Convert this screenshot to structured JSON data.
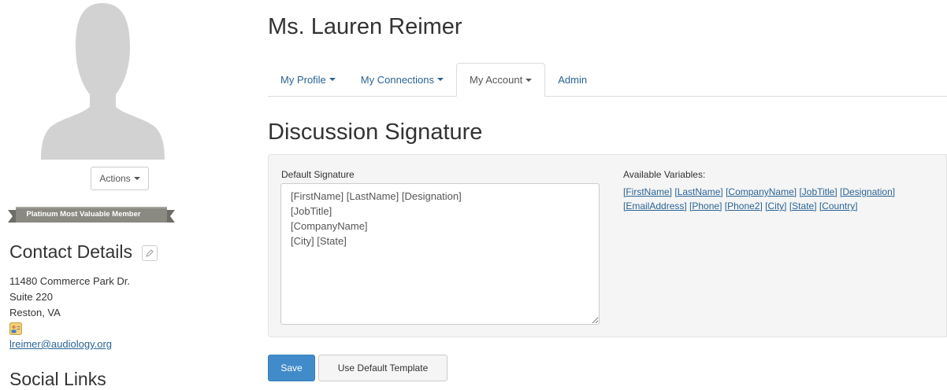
{
  "profile": {
    "actions_label": "Actions",
    "badge_label": "Platinum Most Valuable Member",
    "contact_title": "Contact Details",
    "address_lines": [
      "11480 Commerce Park Dr.",
      "Suite 220",
      "Reston, VA"
    ],
    "email": "lreimer@audiology.org",
    "social_title": "Social Links"
  },
  "header": {
    "name": "Ms. Lauren Reimer"
  },
  "tabs": [
    {
      "label": "My Profile",
      "dropdown": true
    },
    {
      "label": "My Connections",
      "dropdown": true
    },
    {
      "label": "My Account",
      "dropdown": true,
      "active": true
    },
    {
      "label": "Admin",
      "dropdown": false
    }
  ],
  "main": {
    "section_title": "Discussion Signature",
    "signature_label": "Default Signature",
    "signature_value": "[FirstName] [LastName] [Designation]\n[JobTitle]\n[CompanyName]\n[City] [State]",
    "variables_label": "Available Variables:",
    "variables": [
      "[FirstName]",
      "[LastName]",
      "[CompanyName]",
      "[JobTitle]",
      "[Designation]",
      "[EmailAddress]",
      "[Phone]",
      "[Phone2]",
      "[City]",
      "[State]",
      "[Country]"
    ],
    "save_label": "Save",
    "default_label": "Use Default Template"
  },
  "colors": {
    "primary": "#428bca",
    "link": "#2a6496",
    "badge": "#8a8a82"
  }
}
